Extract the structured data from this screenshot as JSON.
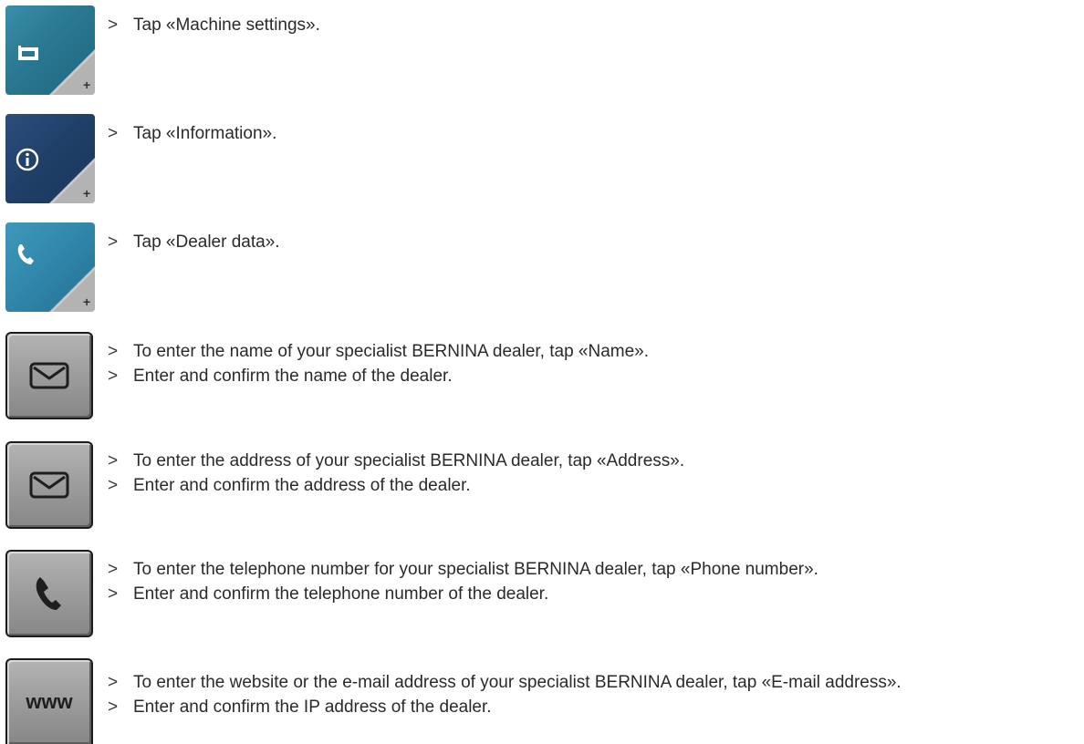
{
  "steps": [
    {
      "icon": "machine-settings-icon",
      "lines": [
        {
          "marker": ">",
          "text": "Tap «Machine settings»."
        }
      ]
    },
    {
      "icon": "information-icon",
      "lines": [
        {
          "marker": ">",
          "text": "Tap «Information»."
        }
      ]
    },
    {
      "icon": "dealer-data-phone-icon",
      "lines": [
        {
          "marker": ">",
          "text": "Tap «Dealer data»."
        }
      ]
    },
    {
      "icon": "envelope-icon",
      "lines": [
        {
          "marker": ">",
          "text": "To enter the name of your specialist BERNINA dealer, tap «Name»."
        },
        {
          "marker": ">",
          "text": "Enter and confirm the name of the dealer."
        }
      ]
    },
    {
      "icon": "envelope-icon",
      "lines": [
        {
          "marker": ">",
          "text": "To enter the address of your specialist BERNINA dealer, tap «Address»."
        },
        {
          "marker": ">",
          "text": "Enter and confirm the address of the dealer."
        }
      ]
    },
    {
      "icon": "phone-icon",
      "lines": [
        {
          "marker": ">",
          "text": "To enter the telephone number for your specialist BERNINA dealer, tap «Phone number»."
        },
        {
          "marker": ">",
          "text": "Enter and confirm the telephone number of the dealer."
        }
      ]
    },
    {
      "icon": "www-icon",
      "icon_text": "www",
      "lines": [
        {
          "marker": ">",
          "text": "To enter the website or the e-mail address of your specialist BERNINA dealer, tap «E-mail address»."
        },
        {
          "marker": ">",
          "text": "Enter and confirm the IP address of the dealer."
        }
      ]
    }
  ],
  "colors": {
    "teal_button": "#2a7791",
    "navy_button": "#1f3f68",
    "sky_button": "#2f86a9",
    "gray_button": "#9c9c9c",
    "text": "#2a2a2a"
  }
}
